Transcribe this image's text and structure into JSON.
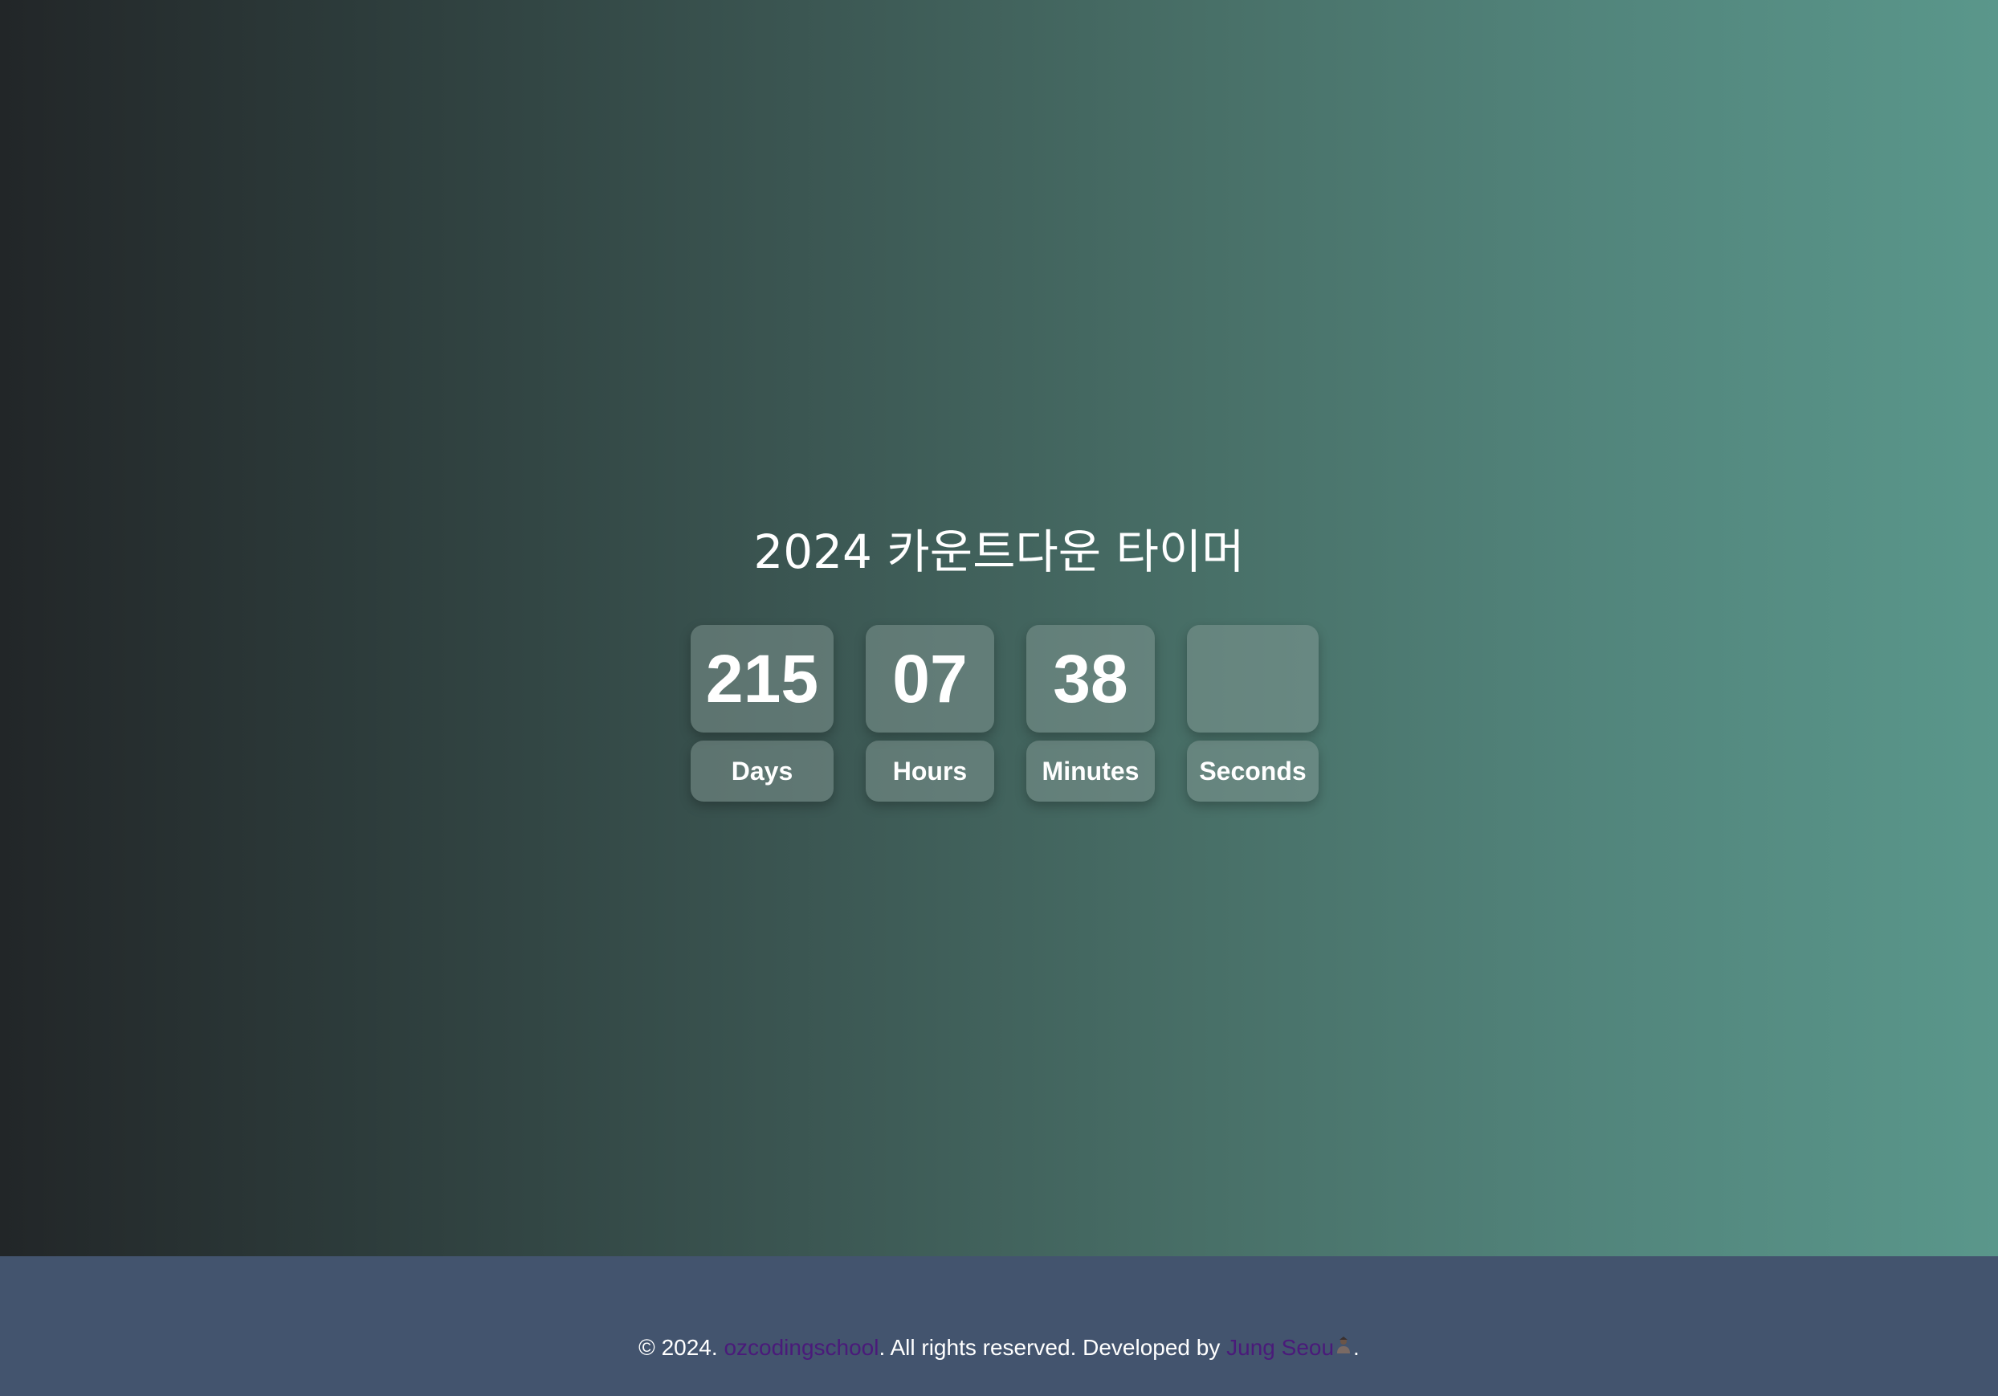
{
  "title": "2024 카운트다운 타이머",
  "timer": {
    "days": {
      "value": "215",
      "label": "Days"
    },
    "hours": {
      "value": "07",
      "label": "Hours"
    },
    "minutes": {
      "value": "38",
      "label": "Minutes"
    },
    "seconds": {
      "value": "",
      "label": "Seconds"
    }
  },
  "footer": {
    "prefix": "© 2024. ",
    "org_link": "ozcodingschool",
    "middle": ". All rights reserved. Developed by ",
    "author_link": "Jung Seou",
    "author_icon": "person-icon",
    "suffix": "."
  },
  "colors": {
    "footer_bg": "#43546e",
    "link": "#4a1a7a",
    "gradient_start": "#222628",
    "gradient_end": "#5a978b"
  }
}
